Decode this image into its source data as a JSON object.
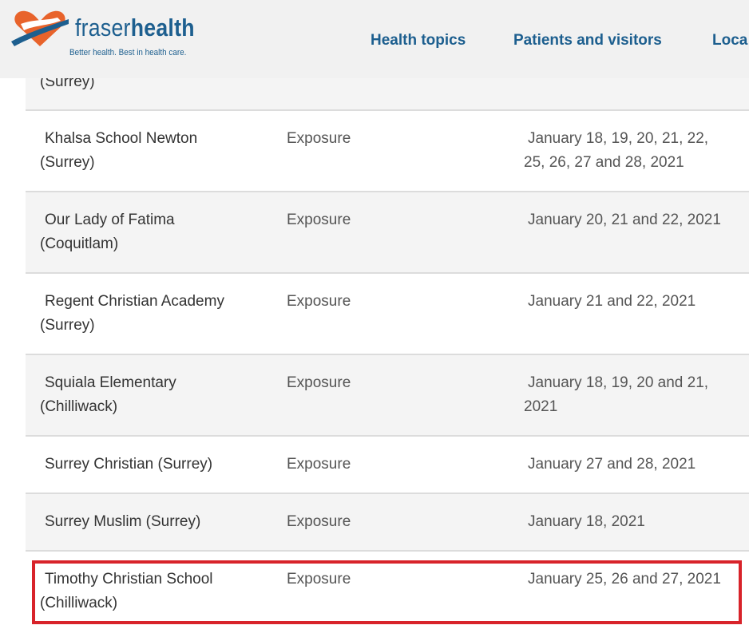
{
  "header": {
    "logo_word_light": "fraser",
    "logo_word_bold": "health",
    "logo_tagline": "Better health. Best in health care.",
    "nav": [
      {
        "label": "Health topics"
      },
      {
        "label": "Patients and visitors"
      },
      {
        "label": "Loca"
      }
    ]
  },
  "colors": {
    "brand_blue": "#1d5f8f",
    "logo_orange": "#e8632b",
    "highlight_red": "#d8232a"
  },
  "rows": [
    {
      "name_line1": "",
      "name_line2": "(Surrey)",
      "type": "",
      "date_line1": "",
      "date_line2": ""
    },
    {
      "name_line1": "Khalsa School Newton",
      "name_line2": "(Surrey)",
      "type": "Exposure",
      "date_line1": "January 18, 19, 20, 21, 22,",
      "date_line2": "25, 26, 27 and 28, 2021"
    },
    {
      "name_line1": "Our Lady of Fatima",
      "name_line2": "(Coquitlam)",
      "type": "Exposure",
      "date_line1": "January 20, 21 and 22, 2021",
      "date_line2": ""
    },
    {
      "name_line1": "Regent Christian Academy",
      "name_line2": "(Surrey)",
      "type": "Exposure",
      "date_line1": "January 21 and 22, 2021",
      "date_line2": ""
    },
    {
      "name_line1": "Squiala Elementary",
      "name_line2": "(Chilliwack)",
      "type": "Exposure",
      "date_line1": "January 18, 19, 20 and 21,",
      "date_line2": "2021"
    },
    {
      "name_line1": "Surrey Christian (Surrey)",
      "name_line2": "",
      "type": "Exposure",
      "date_line1": "January 27 and 28, 2021",
      "date_line2": ""
    },
    {
      "name_line1": "Surrey Muslim (Surrey)",
      "name_line2": "",
      "type": "Exposure",
      "date_line1": "January 18, 2021",
      "date_line2": ""
    },
    {
      "name_line1": "Timothy Christian School",
      "name_line2": "(Chilliwack)",
      "type": "Exposure",
      "date_line1": "January 25, 26 and 27, 2021",
      "date_line2": ""
    }
  ]
}
